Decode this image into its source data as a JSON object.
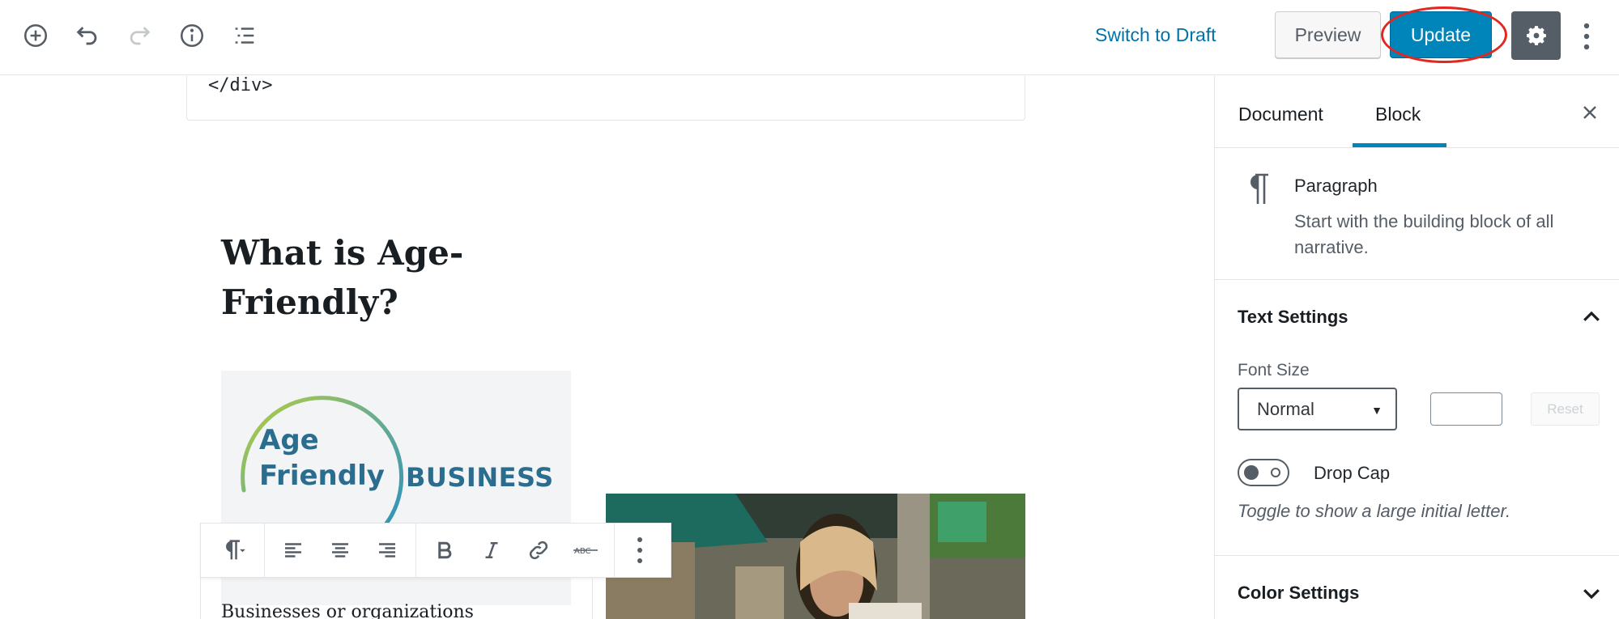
{
  "toolbar": {
    "switch_to_draft": "Switch to Draft",
    "preview": "Preview",
    "update": "Update"
  },
  "editor": {
    "code_line": "</div>",
    "heading_line1": "What is Age-",
    "heading_line2": "Friendly?",
    "logo": {
      "line1": "Age",
      "line2": "Friendly",
      "word": "BUSINESS"
    },
    "paragraph_preview": "Businesses or organizations"
  },
  "sidebar": {
    "tabs": [
      "Document",
      "Block"
    ],
    "active_tab": "Block",
    "block": {
      "name": "Paragraph",
      "description": "Start with the building block of all narrative."
    },
    "text_settings": {
      "title": "Text Settings",
      "font_size_label": "Font Size",
      "font_size_value": "Normal",
      "custom_size": "",
      "reset": "Reset",
      "drop_cap_label": "Drop Cap",
      "drop_cap_help": "Toggle to show a large initial letter.",
      "drop_cap_on": false
    },
    "color_settings": {
      "title": "Color Settings"
    }
  },
  "colors": {
    "accent": "#0085ba",
    "link": "#0073aa",
    "highlight_ring": "#e2271e",
    "settings_bg": "#555d66"
  }
}
